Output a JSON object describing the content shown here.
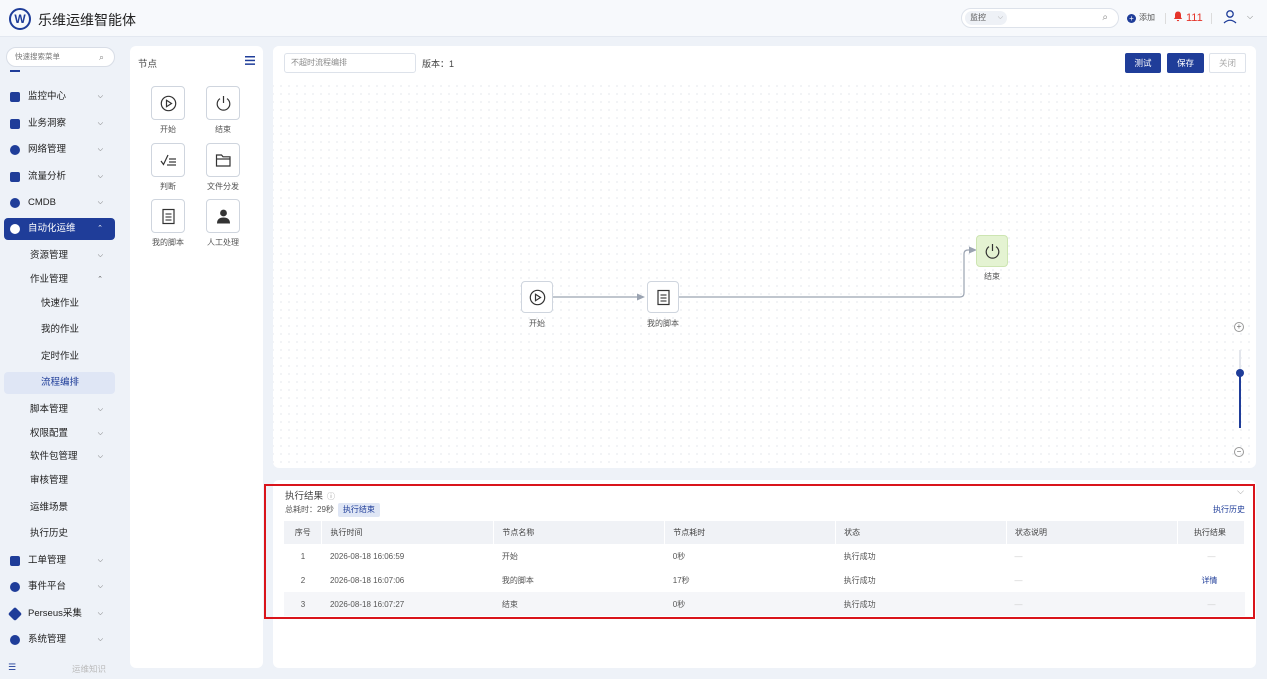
{
  "app": {
    "title": "乐维运维智能体"
  },
  "topbar": {
    "search_category": "监控",
    "add_label": "添加",
    "alarm_count": "111"
  },
  "sidebar": {
    "search_placeholder": "快速搜索菜单",
    "items": [
      {
        "label": "监控中心"
      },
      {
        "label": "业务洞察"
      },
      {
        "label": "网络管理"
      },
      {
        "label": "流量分析"
      },
      {
        "label": "CMDB"
      },
      {
        "label": "自动化运维"
      },
      {
        "label": "工单管理"
      },
      {
        "label": "事件平台"
      },
      {
        "label": "Perseus采集"
      },
      {
        "label": "系统管理"
      }
    ],
    "sub_items": [
      {
        "label": "资源管理"
      },
      {
        "label": "作业管理"
      },
      {
        "label": "脚本管理"
      },
      {
        "label": "权限配置"
      },
      {
        "label": "软件包管理"
      },
      {
        "label": "审核管理"
      },
      {
        "label": "运维场景"
      },
      {
        "label": "执行历史"
      }
    ],
    "job_items": [
      {
        "label": "快速作业"
      },
      {
        "label": "我的作业"
      },
      {
        "label": "定时作业"
      },
      {
        "label": "流程编排"
      }
    ],
    "bottom_text": "运维知识"
  },
  "node_panel": {
    "title": "节点",
    "nodes": [
      {
        "label": "开始",
        "icon": "play-icon"
      },
      {
        "label": "结束",
        "icon": "power-icon"
      },
      {
        "label": "判断",
        "icon": "branch-icon"
      },
      {
        "label": "文件分发",
        "icon": "folder-icon"
      },
      {
        "label": "我的脚本",
        "icon": "script-icon"
      },
      {
        "label": "人工处理",
        "icon": "person-icon"
      }
    ]
  },
  "editor": {
    "flow_name_placeholder": "不超时流程编排",
    "version_label": "版本：1",
    "buttons": {
      "test": "测试",
      "save": "保存",
      "close": "关闭"
    },
    "flow_nodes": [
      {
        "label": "开始"
      },
      {
        "label": "我的脚本"
      },
      {
        "label": "结束"
      }
    ],
    "zoom_level": 0.7
  },
  "result": {
    "title": "执行结果",
    "total_time_label": "总耗时：",
    "total_time_value": "29秒",
    "status_tag": "执行结束",
    "history_link": "执行历史",
    "columns": [
      "序号",
      "执行时间",
      "节点名称",
      "节点耗时",
      "状态",
      "状态说明",
      "执行结果"
    ],
    "rows": [
      {
        "index": "1",
        "time": "2026-08-18 16:06:59",
        "node": "开始",
        "duration": "0秒",
        "status": "执行成功",
        "desc": "—",
        "result": "—"
      },
      {
        "index": "2",
        "time": "2026-08-18 16:07:06",
        "node": "我的脚本",
        "duration": "17秒",
        "status": "执行成功",
        "desc": "—",
        "result": "详情"
      },
      {
        "index": "3",
        "time": "2026-08-18 16:07:27",
        "node": "结束",
        "duration": "0秒",
        "status": "执行成功",
        "desc": "—",
        "result": "—"
      }
    ]
  },
  "colors": {
    "brand": "#1f3d99",
    "alarm": "#e5342a",
    "highlight": "#d9141b",
    "end_node_bg": "#e4f3d2"
  }
}
